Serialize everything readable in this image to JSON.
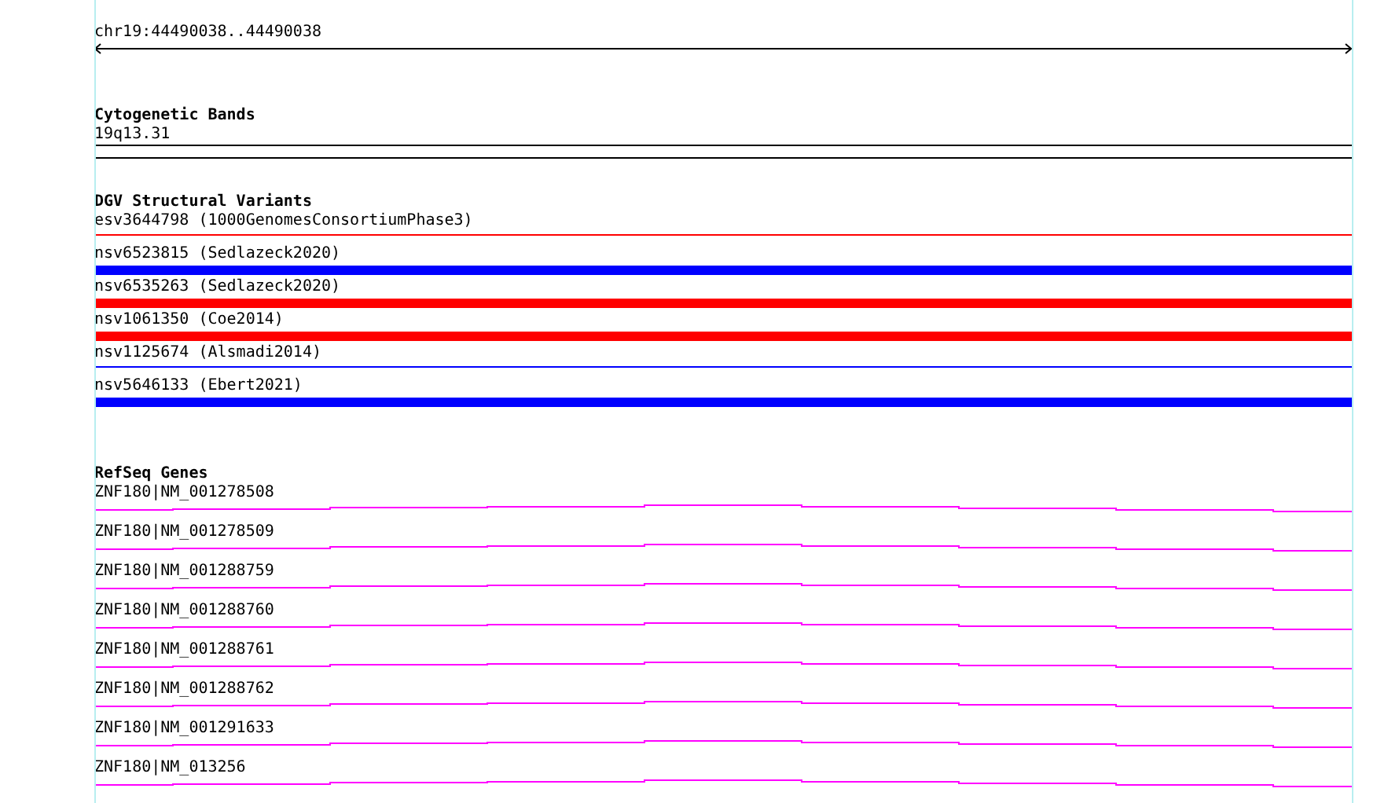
{
  "position": {
    "label": "chr19:44490038..44490038"
  },
  "cytogenetic_bands": {
    "title": "Cytogenetic Bands",
    "bands": [
      {
        "label": "19q13.31"
      }
    ]
  },
  "dgv_variants": {
    "title": "DGV Structural Variants",
    "items": [
      {
        "label": "esv3644798 (1000GenomesConsortiumPhase3)",
        "color": "#ff0000",
        "kind": "thin"
      },
      {
        "label": "nsv6523815 (Sedlazeck2020)",
        "color": "#0000ff",
        "kind": "thick"
      },
      {
        "label": "nsv6535263 (Sedlazeck2020)",
        "color": "#ff0000",
        "kind": "thick"
      },
      {
        "label": "nsv1061350 (Coe2014)",
        "color": "#ff0000",
        "kind": "thick"
      },
      {
        "label": "nsv1125674 (Alsmadi2014)",
        "color": "#0000ff",
        "kind": "thin"
      },
      {
        "label": "nsv5646133 (Ebert2021)",
        "color": "#0000ff",
        "kind": "thick"
      }
    ]
  },
  "refseq_genes": {
    "title": "RefSeq Genes",
    "items": [
      {
        "label": "ZNF180|NM_001278508"
      },
      {
        "label": "ZNF180|NM_001278509"
      },
      {
        "label": "ZNF180|NM_001288759"
      },
      {
        "label": "ZNF180|NM_001288760"
      },
      {
        "label": "ZNF180|NM_001288761"
      },
      {
        "label": "ZNF180|NM_001288762"
      },
      {
        "label": "ZNF180|NM_001291633"
      },
      {
        "label": "ZNF180|NM_013256"
      }
    ]
  }
}
